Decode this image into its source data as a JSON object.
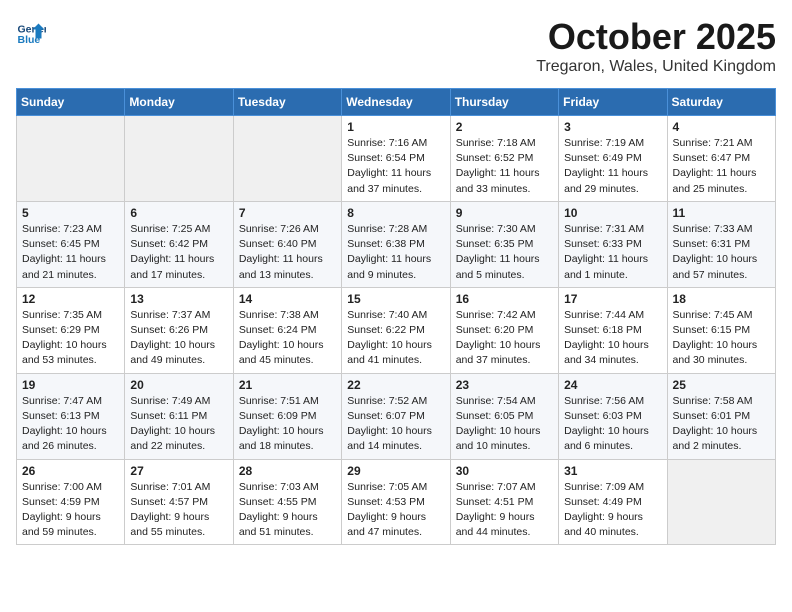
{
  "header": {
    "logo_line1": "General",
    "logo_line2": "Blue",
    "month": "October 2025",
    "location": "Tregaron, Wales, United Kingdom"
  },
  "days_of_week": [
    "Sunday",
    "Monday",
    "Tuesday",
    "Wednesday",
    "Thursday",
    "Friday",
    "Saturday"
  ],
  "weeks": [
    [
      {
        "day": "",
        "content": ""
      },
      {
        "day": "",
        "content": ""
      },
      {
        "day": "",
        "content": ""
      },
      {
        "day": "1",
        "content": "Sunrise: 7:16 AM\nSunset: 6:54 PM\nDaylight: 11 hours\nand 37 minutes."
      },
      {
        "day": "2",
        "content": "Sunrise: 7:18 AM\nSunset: 6:52 PM\nDaylight: 11 hours\nand 33 minutes."
      },
      {
        "day": "3",
        "content": "Sunrise: 7:19 AM\nSunset: 6:49 PM\nDaylight: 11 hours\nand 29 minutes."
      },
      {
        "day": "4",
        "content": "Sunrise: 7:21 AM\nSunset: 6:47 PM\nDaylight: 11 hours\nand 25 minutes."
      }
    ],
    [
      {
        "day": "5",
        "content": "Sunrise: 7:23 AM\nSunset: 6:45 PM\nDaylight: 11 hours\nand 21 minutes."
      },
      {
        "day": "6",
        "content": "Sunrise: 7:25 AM\nSunset: 6:42 PM\nDaylight: 11 hours\nand 17 minutes."
      },
      {
        "day": "7",
        "content": "Sunrise: 7:26 AM\nSunset: 6:40 PM\nDaylight: 11 hours\nand 13 minutes."
      },
      {
        "day": "8",
        "content": "Sunrise: 7:28 AM\nSunset: 6:38 PM\nDaylight: 11 hours\nand 9 minutes."
      },
      {
        "day": "9",
        "content": "Sunrise: 7:30 AM\nSunset: 6:35 PM\nDaylight: 11 hours\nand 5 minutes."
      },
      {
        "day": "10",
        "content": "Sunrise: 7:31 AM\nSunset: 6:33 PM\nDaylight: 11 hours\nand 1 minute."
      },
      {
        "day": "11",
        "content": "Sunrise: 7:33 AM\nSunset: 6:31 PM\nDaylight: 10 hours\nand 57 minutes."
      }
    ],
    [
      {
        "day": "12",
        "content": "Sunrise: 7:35 AM\nSunset: 6:29 PM\nDaylight: 10 hours\nand 53 minutes."
      },
      {
        "day": "13",
        "content": "Sunrise: 7:37 AM\nSunset: 6:26 PM\nDaylight: 10 hours\nand 49 minutes."
      },
      {
        "day": "14",
        "content": "Sunrise: 7:38 AM\nSunset: 6:24 PM\nDaylight: 10 hours\nand 45 minutes."
      },
      {
        "day": "15",
        "content": "Sunrise: 7:40 AM\nSunset: 6:22 PM\nDaylight: 10 hours\nand 41 minutes."
      },
      {
        "day": "16",
        "content": "Sunrise: 7:42 AM\nSunset: 6:20 PM\nDaylight: 10 hours\nand 37 minutes."
      },
      {
        "day": "17",
        "content": "Sunrise: 7:44 AM\nSunset: 6:18 PM\nDaylight: 10 hours\nand 34 minutes."
      },
      {
        "day": "18",
        "content": "Sunrise: 7:45 AM\nSunset: 6:15 PM\nDaylight: 10 hours\nand 30 minutes."
      }
    ],
    [
      {
        "day": "19",
        "content": "Sunrise: 7:47 AM\nSunset: 6:13 PM\nDaylight: 10 hours\nand 26 minutes."
      },
      {
        "day": "20",
        "content": "Sunrise: 7:49 AM\nSunset: 6:11 PM\nDaylight: 10 hours\nand 22 minutes."
      },
      {
        "day": "21",
        "content": "Sunrise: 7:51 AM\nSunset: 6:09 PM\nDaylight: 10 hours\nand 18 minutes."
      },
      {
        "day": "22",
        "content": "Sunrise: 7:52 AM\nSunset: 6:07 PM\nDaylight: 10 hours\nand 14 minutes."
      },
      {
        "day": "23",
        "content": "Sunrise: 7:54 AM\nSunset: 6:05 PM\nDaylight: 10 hours\nand 10 minutes."
      },
      {
        "day": "24",
        "content": "Sunrise: 7:56 AM\nSunset: 6:03 PM\nDaylight: 10 hours\nand 6 minutes."
      },
      {
        "day": "25",
        "content": "Sunrise: 7:58 AM\nSunset: 6:01 PM\nDaylight: 10 hours\nand 2 minutes."
      }
    ],
    [
      {
        "day": "26",
        "content": "Sunrise: 7:00 AM\nSunset: 4:59 PM\nDaylight: 9 hours\nand 59 minutes."
      },
      {
        "day": "27",
        "content": "Sunrise: 7:01 AM\nSunset: 4:57 PM\nDaylight: 9 hours\nand 55 minutes."
      },
      {
        "day": "28",
        "content": "Sunrise: 7:03 AM\nSunset: 4:55 PM\nDaylight: 9 hours\nand 51 minutes."
      },
      {
        "day": "29",
        "content": "Sunrise: 7:05 AM\nSunset: 4:53 PM\nDaylight: 9 hours\nand 47 minutes."
      },
      {
        "day": "30",
        "content": "Sunrise: 7:07 AM\nSunset: 4:51 PM\nDaylight: 9 hours\nand 44 minutes."
      },
      {
        "day": "31",
        "content": "Sunrise: 7:09 AM\nSunset: 4:49 PM\nDaylight: 9 hours\nand 40 minutes."
      },
      {
        "day": "",
        "content": ""
      }
    ]
  ]
}
